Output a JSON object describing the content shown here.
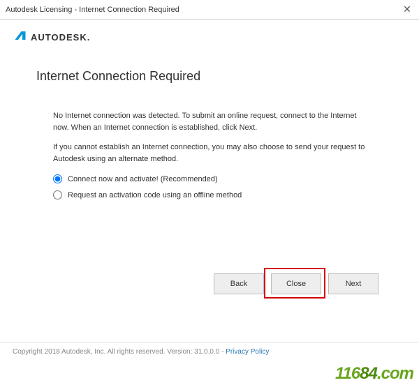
{
  "titlebar": {
    "title": "Autodesk Licensing - Internet Connection Required"
  },
  "brand": "AUTODESK.",
  "page_title": "Internet Connection Required",
  "para1": "No Internet connection was detected. To submit an online request, connect to the Internet now. When an Internet connection is established, click Next.",
  "para2": "If you cannot establish an Internet connection, you may also choose to send your request to Autodesk using an alternate method.",
  "radio1": "Connect now and activate! (Recommended)",
  "radio2": "Request an activation code using an offline method",
  "buttons": {
    "back": "Back",
    "close": "Close",
    "next": "Next"
  },
  "footer": {
    "copyright": "Copyright 2018 Autodesk, Inc. All rights reserved. Version: 31.0.0.0 - ",
    "policy": "Privacy Policy"
  },
  "watermark": "11684.com"
}
